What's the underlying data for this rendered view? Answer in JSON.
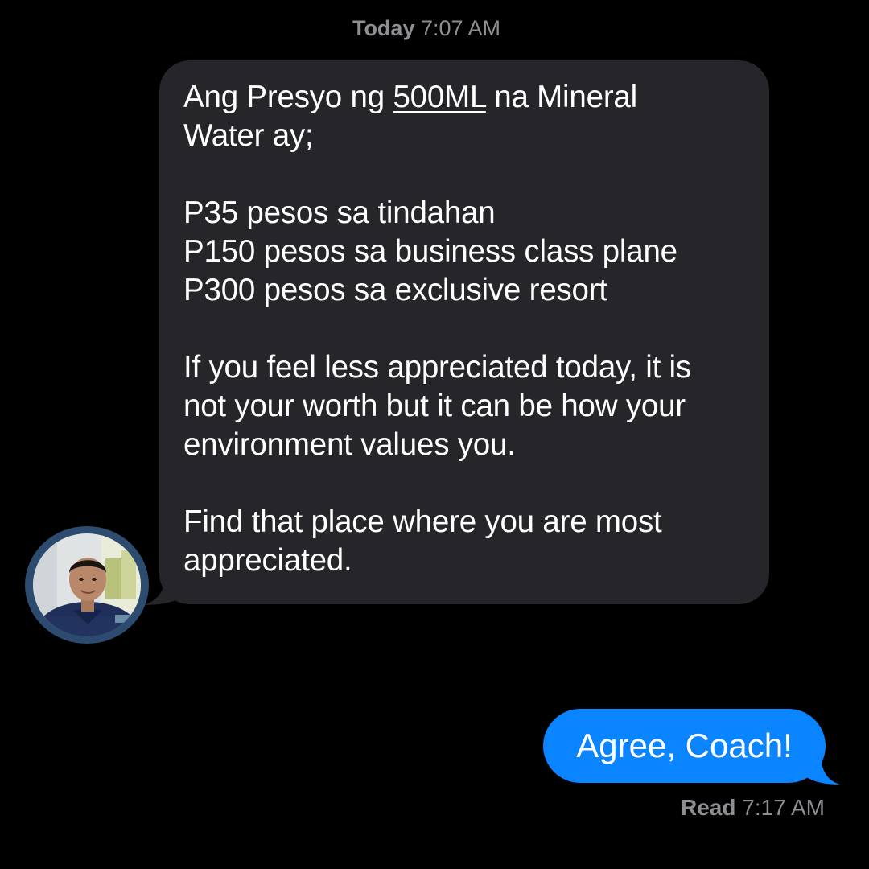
{
  "timestamp": {
    "day": "Today",
    "time": "7:07 AM"
  },
  "incoming_message": {
    "line1_prefix": "Ang Presyo ng ",
    "line1_underlined": "500ML",
    "line1_suffix": " na Mineral",
    "line2": "Water ay;",
    "price_lines": [
      "P35 pesos sa tindahan",
      "P150 pesos sa business class plane",
      "P300 pesos sa exclusive resort"
    ],
    "para2_lines": [
      "If you feel less appreciated today, it is",
      "not your worth but it can be how your",
      "environment values you."
    ],
    "para3_lines": [
      "Find that place where you are most",
      "appreciated."
    ]
  },
  "outgoing_message": {
    "text": "Agree, Coach!"
  },
  "read_receipt": {
    "label": "Read",
    "time": "7:17 AM"
  },
  "colors": {
    "background": "#000000",
    "incoming_bubble": "#26252a",
    "outgoing_bubble": "#0a84ff",
    "meta_text": "#8e8e93"
  },
  "icons": {
    "avatar": "profile-photo"
  }
}
